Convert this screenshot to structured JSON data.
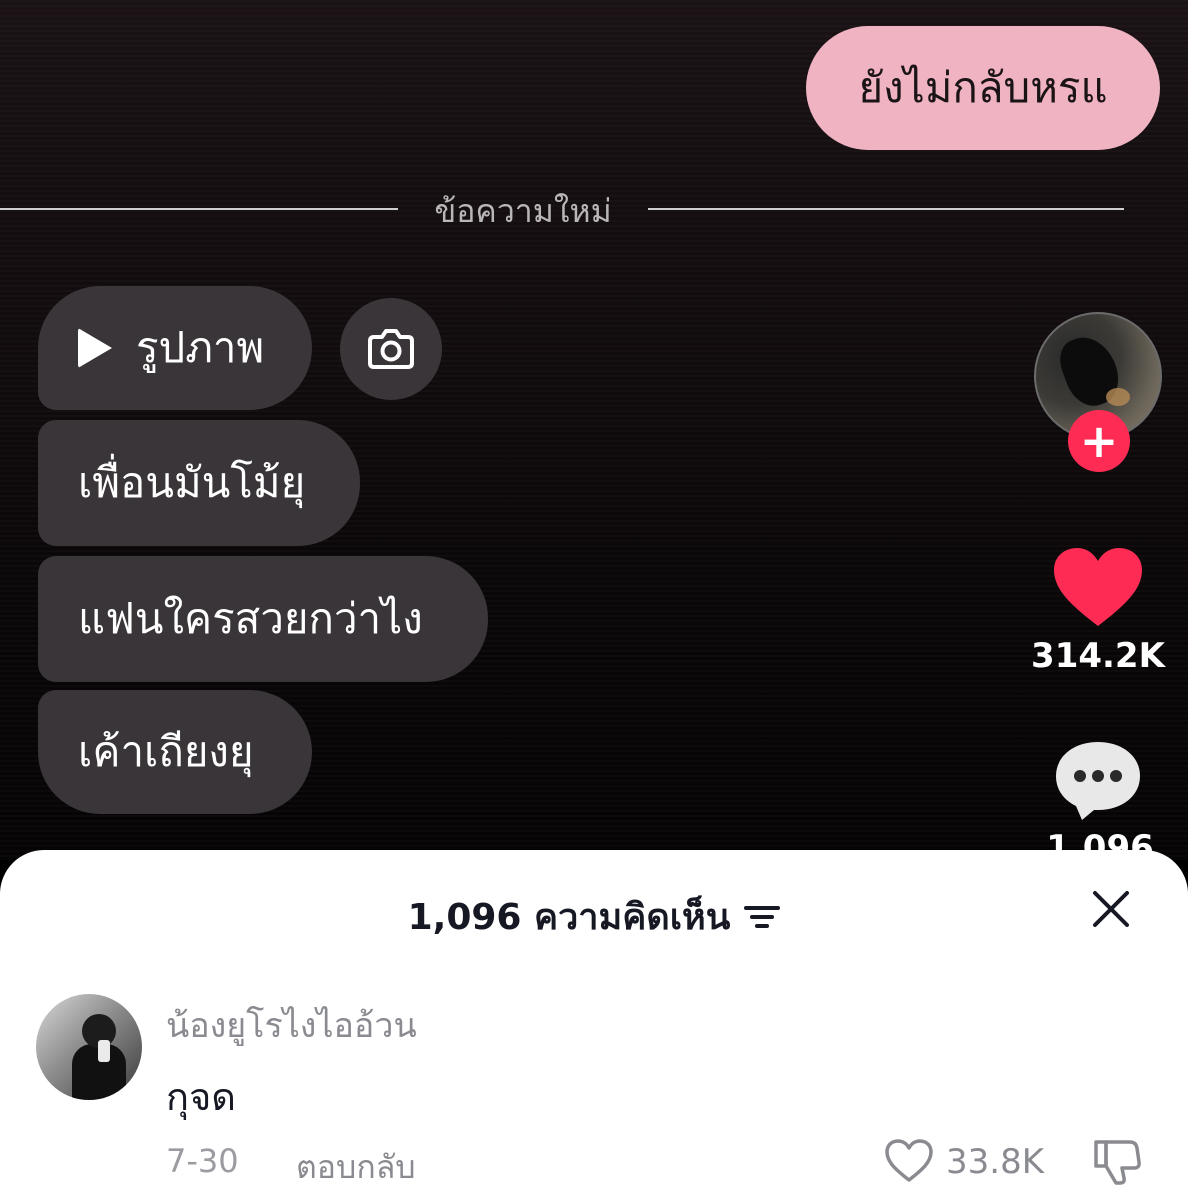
{
  "chat": {
    "sent_message": "ยังไม่กลับหรแ",
    "divider_label": "ข้อความใหม่",
    "received": [
      {
        "text": "รูปภาพ",
        "type": "media"
      },
      {
        "text": "เพื่อนมันโม้ยุ",
        "type": "text"
      },
      {
        "text": "แฟนใครสวยกว่าไง",
        "type": "text"
      },
      {
        "text": "เค้าเถียงยุ",
        "type": "text"
      }
    ],
    "colors": {
      "sent_bubble": "#efb3c2",
      "received_bubble": "#3a3538"
    }
  },
  "sidebar": {
    "avatar_icon": "profile-avatar",
    "follow_icon": "plus-icon",
    "like_count": "314.2K",
    "comment_count": "1,096",
    "like_color": "#fe2c55"
  },
  "comments_sheet": {
    "title": "1,096 ความคิดเห็น",
    "sort_icon": "sort-icon",
    "close_icon": "close-icon",
    "comment": {
      "username": "น้องยูโรไงไออ้วน",
      "text": "กุจด",
      "date": "7-30",
      "reply_label": "ตอบกลับ",
      "likes": "33.8K"
    }
  }
}
